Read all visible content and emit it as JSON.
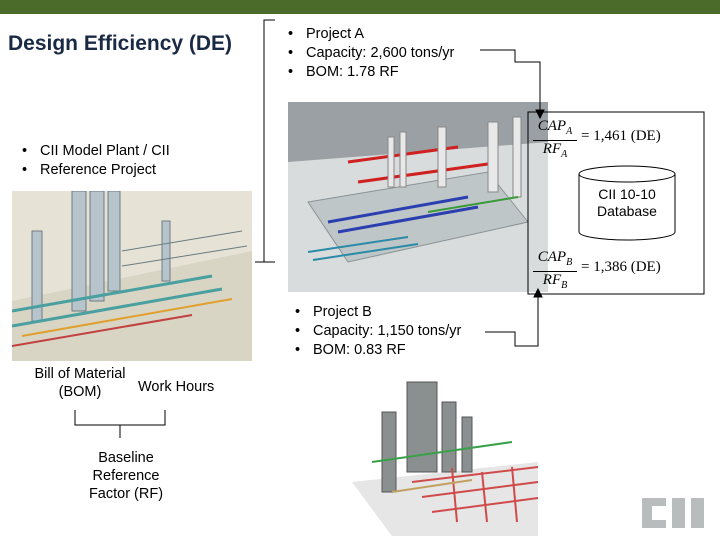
{
  "title": "Design Efficiency (DE)",
  "project_a": {
    "bullets": [
      "Project A",
      "Capacity: 2,600 tons/yr",
      "BOM: 1.78 RF"
    ]
  },
  "project_b": {
    "bullets": [
      "Project B",
      "Capacity: 1,150 tons/yr",
      "BOM: 0.83 RF"
    ]
  },
  "model_plant": {
    "bullets": [
      "CII Model Plant / CII",
      "Reference Project"
    ]
  },
  "database": {
    "label_line1": "CII 10-10",
    "label_line2": "Database"
  },
  "formula_a": {
    "num": "CAP",
    "num_sub": "A",
    "den": "RF",
    "den_sub": "A",
    "result": "= 1,461 (DE)"
  },
  "formula_b": {
    "num": "CAP",
    "num_sub": "B",
    "den": "RF",
    "den_sub": "B",
    "result": "= 1,386 (DE)"
  },
  "bom": {
    "line1": "Bill of Material",
    "line2": "(BOM)"
  },
  "work_hours": "Work Hours",
  "baseline": {
    "line1": "Baseline",
    "line2": "Reference",
    "line3": "Factor (RF)"
  },
  "logo_text": "CII",
  "colors": {
    "topbar": "#4a6b2a",
    "title": "#1a2a45"
  }
}
